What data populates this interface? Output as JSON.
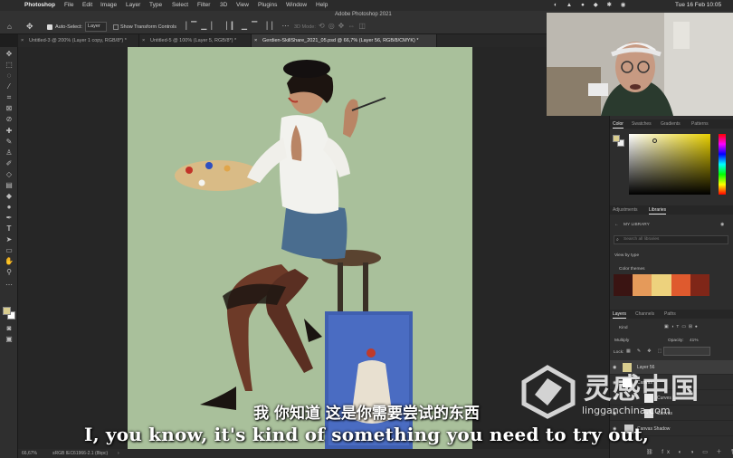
{
  "menubar": {
    "app": "Photoshop",
    "items": [
      "File",
      "Edit",
      "Image",
      "Layer",
      "Type",
      "Select",
      "Filter",
      "3D",
      "View",
      "Plugins",
      "Window",
      "Help"
    ],
    "clock": "Tue 16 Feb  10:05"
  },
  "window_title": "Adobe Photoshop 2021",
  "options": {
    "auto_select_label": "Auto-Select:",
    "auto_select_value": "Layer",
    "show_transform_label": "Show Transform Controls",
    "mode_3d": "3D Mode:"
  },
  "tabs": [
    {
      "label": "Untitled-3 @ 200% (Layer 1 copy, RGB/8*) *"
    },
    {
      "label": "Untitled-5 @ 100% (Layer 5, RGB/8*) *"
    },
    {
      "label": "Gerdien-SkillShare_2021_05.psd @ 66,7% (Layer 56, RGB/8/CMYK) *"
    }
  ],
  "status": {
    "zoom": "66,67%",
    "profile": "sRGB IEC61966-2.1 (8bpc)"
  },
  "panels": {
    "color_tabs": [
      "Color",
      "Swatches",
      "Gradients",
      "Patterns"
    ],
    "lib_tabs": [
      "Adjustments",
      "Libraries"
    ],
    "library_name": "MY LIBRARY",
    "search_placeholder": "Search all libraries",
    "view_by": "View by type",
    "color_themes": "Color themes",
    "theme_colors": [
      "#3a1412",
      "#e59a5a",
      "#edd27d",
      "#df5a2e",
      "#7f2618"
    ],
    "layer_tabs": [
      "Layers",
      "Channels",
      "Paths"
    ],
    "kind_label": "Kind",
    "blend_mode": "Multiply",
    "opacity_label": "Opacity:",
    "opacity_value": "41%",
    "lock_label": "Lock:",
    "fill_label": "Fill:",
    "layers": [
      {
        "name": "Layer 56"
      },
      {
        "name": "Canvas"
      },
      {
        "name": "Curves 1"
      },
      {
        "name": "Canvas"
      },
      {
        "name": "Canvas Shadow"
      }
    ]
  },
  "subtitles": {
    "chinese": "我 你知道 这是你需要尝试的东西",
    "english": "I, you know, it's kind of something you need to try out,"
  },
  "watermark": {
    "chinese": "灵感中国",
    "url": "lingganchina.com"
  },
  "colors": {
    "foreground": "#d9cd8f",
    "canvas_bg": "#a9c09b",
    "accent": "#2d8ceb"
  }
}
